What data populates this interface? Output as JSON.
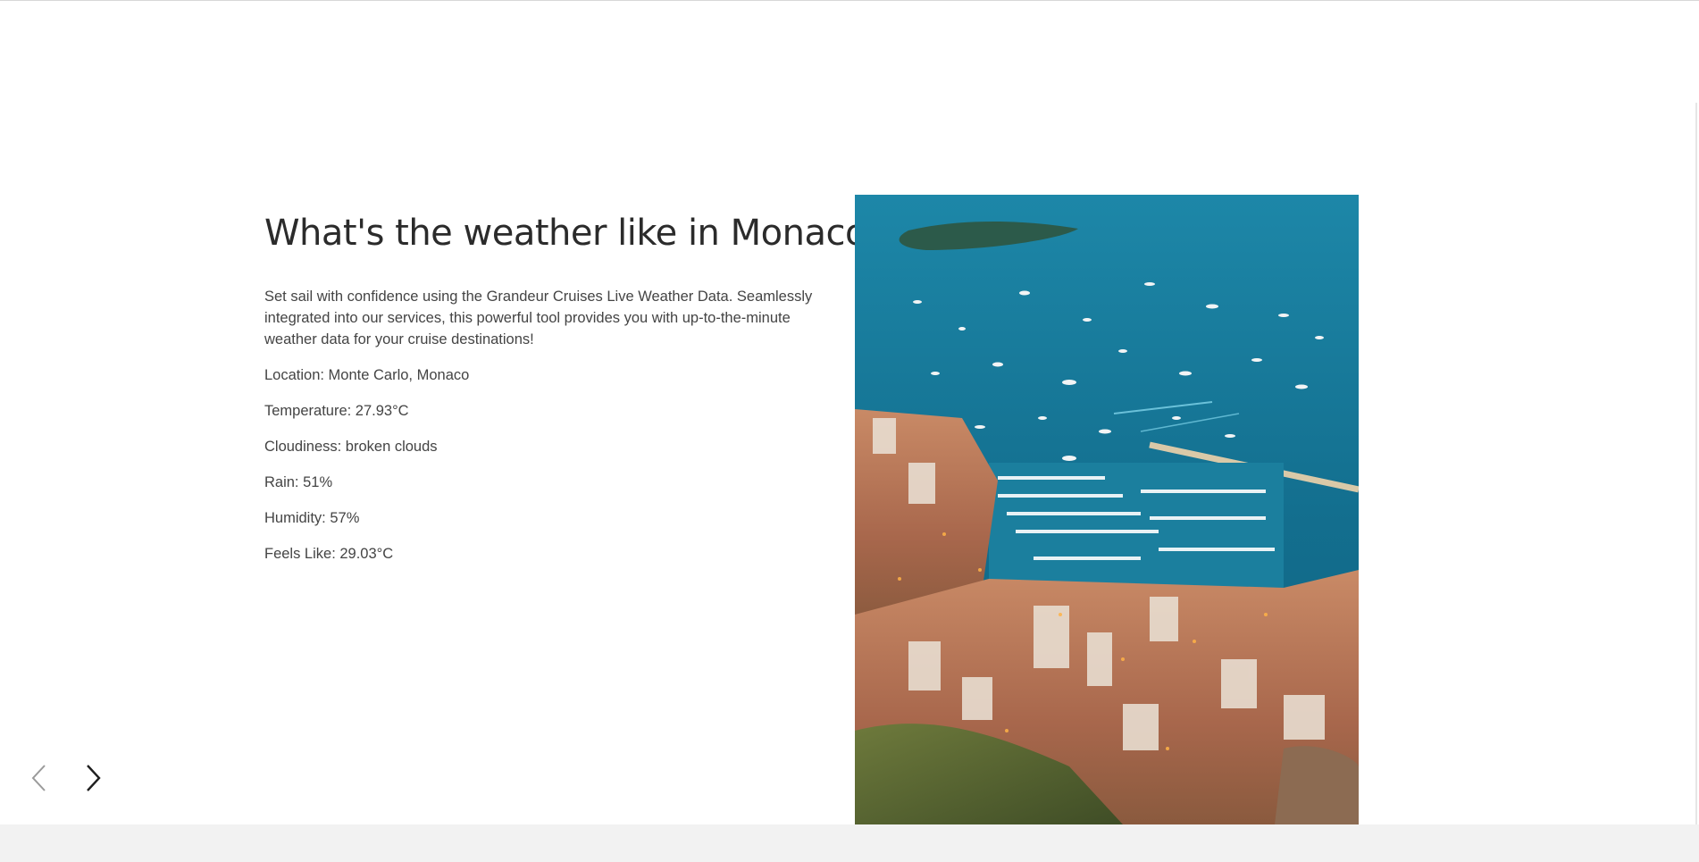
{
  "content": {
    "heading": "What's the weather like in Monaco?",
    "intro": "Set sail with confidence using the Grandeur Cruises Live Weather Data. Seamlessly integrated into our services, this powerful tool provides you with up-to-the-minute weather data for your cruise destinations!",
    "facts": [
      "Location: Monte Carlo, Monaco",
      "Temperature: 27.93°C",
      "Cloudiness: broken clouds",
      "Rain: 51%",
      "Humidity: 57%",
      "Feels Like: 29.03°C"
    ]
  },
  "navigation": {
    "prev_icon": "chevron-left-icon",
    "next_icon": "chevron-right-icon"
  },
  "image": {
    "subject": "aerial-photo-monaco-harbor",
    "colors": {
      "sea": "#17789a",
      "city": "#b87a5c",
      "vegetation": "#5c6b3a"
    }
  }
}
